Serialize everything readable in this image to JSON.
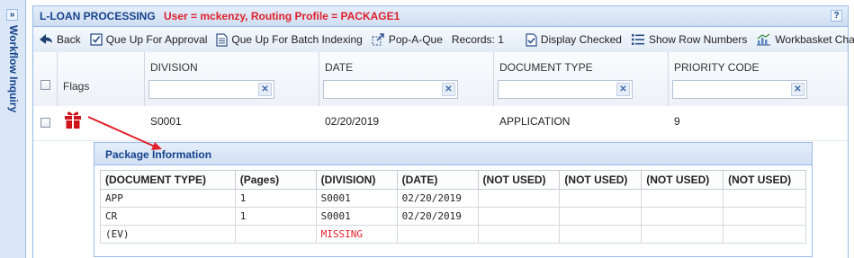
{
  "side_panel": {
    "title": "Workflow Inquiry",
    "expand_glyph": "»"
  },
  "window": {
    "title": "L-LOAN PROCESSING",
    "user_info": "User = mckenzy, Routing Profile = PACKAGE1",
    "help_glyph": "?"
  },
  "toolbar": {
    "back": "Back",
    "queue_up_approval": "Que Up For Approval",
    "queue_up_batch": "Que Up For Batch Indexing",
    "pop_a_que": "Pop-A-Que",
    "records": "Records: 1",
    "display_checked": "Display Checked",
    "show_row_numbers": "Show Row Numbers",
    "workbasket_charts": "Workbasket Charts"
  },
  "grid": {
    "columns": {
      "flags": "Flags",
      "division": "DIVISION",
      "date": "DATE",
      "document_type": "DOCUMENT TYPE",
      "priority_code": "PRIORITY CODE"
    },
    "filter_clear_glyph": "✕",
    "row": {
      "flag_icon": "gift-icon",
      "division": "S0001",
      "date": "02/20/2019",
      "document_type": "APPLICATION",
      "priority_code": "9"
    }
  },
  "package_info": {
    "title": "Package Information",
    "headers": [
      "(DOCUMENT TYPE)",
      "(Pages)",
      "(DIVISION)",
      "(DATE)",
      "(NOT USED)",
      "(NOT USED)",
      "(NOT USED)",
      "(NOT USED)"
    ],
    "rows": [
      [
        "APP",
        "1",
        "S0001",
        "02/20/2019",
        "",
        "",
        "",
        ""
      ],
      [
        "CR",
        "1",
        "S0001",
        "02/20/2019",
        "",
        "",
        "",
        ""
      ],
      [
        "(EV)",
        "",
        "MISSING",
        "",
        "",
        "",
        "",
        ""
      ]
    ]
  },
  "colors": {
    "accent": "#15428b",
    "alert": "#e0202a",
    "flag": "#d0121b",
    "arrow": "#e0202a"
  }
}
